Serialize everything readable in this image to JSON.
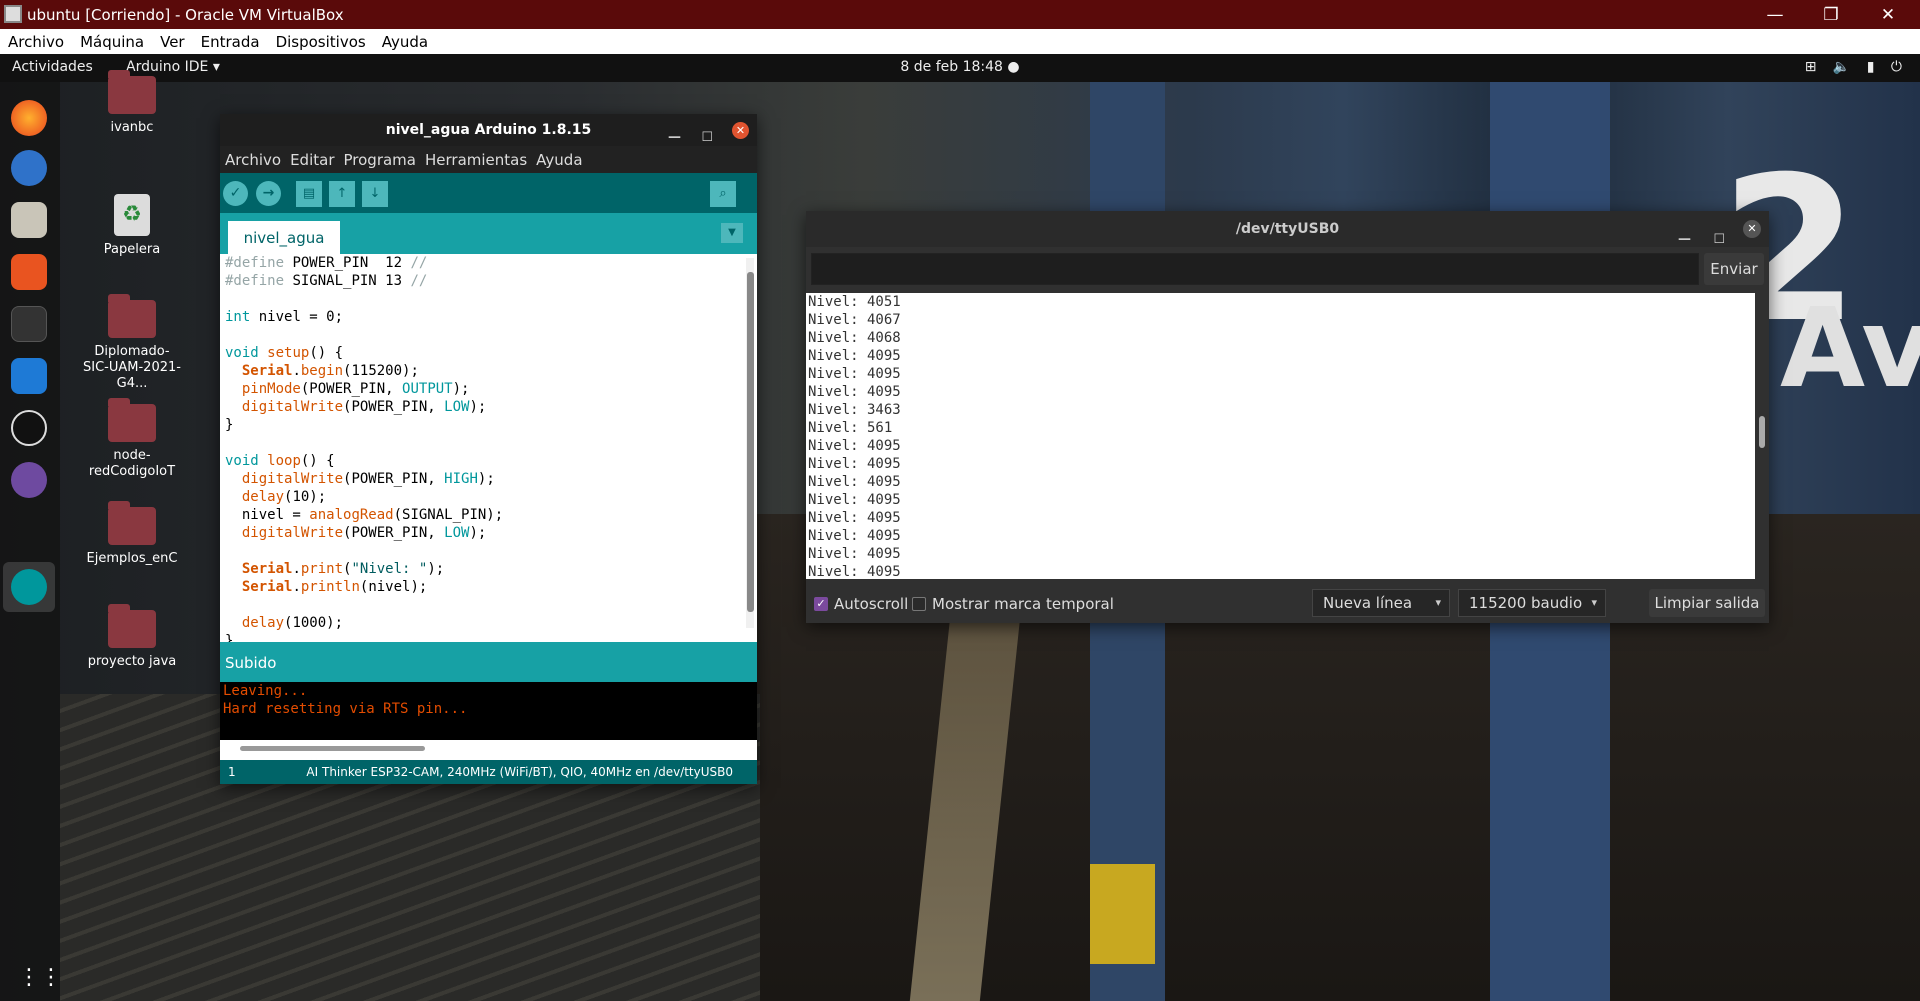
{
  "host": {
    "title": "ubuntu [Corriendo] - Oracle VM VirtualBox",
    "menu": [
      "Archivo",
      "Máquina",
      "Ver",
      "Entrada",
      "Dispositivos",
      "Ayuda"
    ]
  },
  "topbar": {
    "activities": "Actividades",
    "app_menu": "Arduino IDE ▾",
    "clock": "8 de feb  18:48  ●",
    "tray": "⊞ 🔈 ▮ ⏻"
  },
  "desktop_icons": [
    "ivanbc",
    "Papelera",
    "Diplomado-SIC-UAM-2021-G4...",
    "node-redCodigoIoT",
    "Ejemplos_enC",
    "proyecto java"
  ],
  "arduino": {
    "title": "nivel_agua Arduino 1.8.15",
    "menu": [
      "Archivo",
      "Editar",
      "Programa",
      "Herramientas",
      "Ayuda"
    ],
    "tab": "nivel_agua",
    "status": "Subido",
    "console": [
      "Leaving...",
      "Hard resetting via RTS pin..."
    ],
    "footer_line": "1",
    "footer_board": "AI Thinker ESP32-CAM, 240MHz (WiFi/BT), QIO, 40MHz en /dev/ttyUSB0"
  },
  "serial": {
    "title": "/dev/ttyUSB0",
    "input_value": "",
    "send_label": "Enviar",
    "lines": [
      "Nivel: 4051",
      "Nivel: 4067",
      "Nivel: 4068",
      "Nivel: 4095",
      "Nivel: 4095",
      "Nivel: 4095",
      "Nivel: 3463",
      "Nivel: 561",
      "Nivel: 4095",
      "Nivel: 4095",
      "Nivel: 4095",
      "Nivel: 4095",
      "Nivel: 4095",
      "Nivel: 4095",
      "Nivel: 4095",
      "Nivel: 4095"
    ],
    "autoscroll_label": "Autoscroll",
    "autoscroll_checked": true,
    "timestamp_label": "Mostrar marca temporal",
    "timestamp_checked": false,
    "line_ending": "Nueva línea",
    "baud": "115200 baudio",
    "clear_label": "Limpiar salida"
  }
}
